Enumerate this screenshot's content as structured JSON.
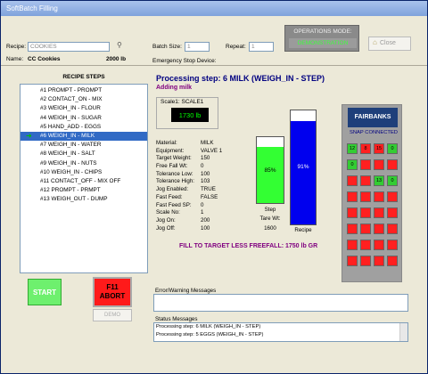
{
  "window": {
    "title": "SoftBatch Filling"
  },
  "header": {
    "recipe_label": "Recipe:",
    "recipe_value": "COOKIES",
    "name_label": "Name:",
    "name_value": "CC Cookies",
    "batch_weight": "2000  lb",
    "batch_size_label": "Batch Size:",
    "batch_size_value": "1",
    "repeat_label": "Repeat:",
    "repeat_value": "1",
    "estop_label": "Emergency Stop Device:",
    "opmode_label": "OPERATIONS MODE:",
    "opmode_value": "DEMONSTRATION",
    "close_label": "Close"
  },
  "recipe_steps": {
    "title": "RECIPE STEPS",
    "items": [
      "#1 PROMPT - PROMPT",
      "#2 CONTACT_ON - MIX",
      "#3 WEIGH_IN - FLOUR",
      "#4 WEIGH_IN - SUGAR",
      "#5 HAND_ADD - EGGS",
      "#6 WEIGH_IN - MILK",
      "#7 WEIGH_IN - WATER",
      "#8 WEIGH_IN - SALT",
      "#9 WEIGH_IN - NUTS",
      "#10 WEIGH_IN - CHIPS",
      "#11 CONTACT_OFF - MIX OFF",
      "#12 PROMPT - PRMPT",
      "#13 WEIGH_OUT - DUMP"
    ],
    "selected_index": 5
  },
  "buttons": {
    "start": "START",
    "abort_line1": "F11",
    "abort_line2": "ABORT",
    "demo": "DEMO"
  },
  "process": {
    "title": "Processing step: 6  MILK   (WEIGH_IN - STEP)",
    "subtitle": "Adding milk",
    "scale_label": "Scale1: SCALE1",
    "scale_value": "1730 lb",
    "params": [
      {
        "k": "Material:",
        "v": "MILK"
      },
      {
        "k": "Equipment:",
        "v": "VALVE 1"
      },
      {
        "k": "Target Weight:",
        "v": "150"
      },
      {
        "k": "Free Fall Wt:",
        "v": "0"
      },
      {
        "k": "Tolerance Low:",
        "v": "100"
      },
      {
        "k": "Tolerance High:",
        "v": "103"
      },
      {
        "k": "Jog Enabled:",
        "v": "TRUE"
      },
      {
        "k": "Fast Feed:",
        "v": "FALSE"
      },
      {
        "k": "Fast Feed SP:",
        "v": "0"
      },
      {
        "k": "Scale No:",
        "v": "1"
      },
      {
        "k": "Jog On:",
        "v": "200"
      },
      {
        "k": "Jog Off:",
        "v": "100"
      }
    ],
    "step_bar": {
      "pct_label": "85%",
      "fraction": 0.85,
      "label": "Step",
      "color": "#33ff33"
    },
    "recipe_bar": {
      "pct_label": "91%",
      "fraction": 0.91,
      "label": "Recipe",
      "color": "#0000ee"
    },
    "tare_label": "Tare Wt:",
    "tare_value": "1600",
    "fill_target": "FILL TO TARGET LESS FREEFALL: 1750 lb  GR"
  },
  "fairbanks": {
    "logo": "FAIRBANKS",
    "status": "SNAP CONNECTED",
    "io_cells": [
      [
        "12",
        "8",
        "15",
        "0"
      ],
      [
        "0",
        "",
        "",
        ""
      ],
      [
        "",
        "",
        "13",
        "0"
      ],
      [
        "",
        "",
        "",
        ""
      ],
      [
        "",
        "",
        "",
        ""
      ],
      [
        "",
        "",
        "",
        ""
      ],
      [
        "",
        "",
        "",
        ""
      ],
      [
        "",
        "",
        "",
        ""
      ]
    ]
  },
  "messages": {
    "error_label": "Error/Warning Messages",
    "status_label": "Status Messages",
    "status_lines": [
      "Processing step: 6  MILK    (WEIGH_IN - STEP)",
      "Processing step: 5  EGGS    (WEIGH_IN - STEP)"
    ]
  }
}
